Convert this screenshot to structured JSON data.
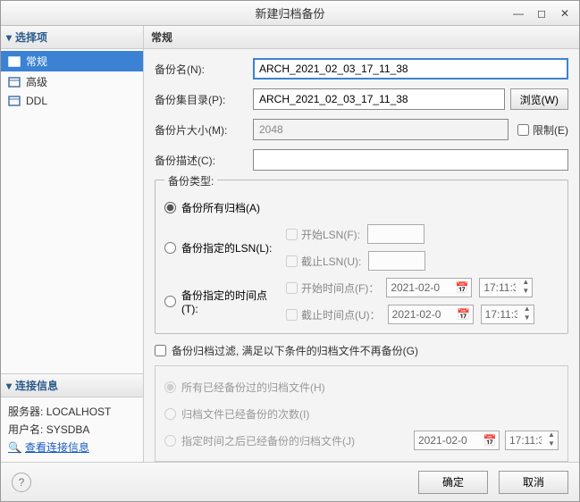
{
  "window": {
    "title": "新建归档备份"
  },
  "sidebar": {
    "options_header": "选择项",
    "items": [
      {
        "label": "常规"
      },
      {
        "label": "高级"
      },
      {
        "label": "DDL"
      }
    ],
    "conn_header": "连接信息",
    "server_label": "服务器:",
    "server_value": "LOCALHOST",
    "user_label": "用户名:",
    "user_value": "SYSDBA",
    "link": "查看连接信息"
  },
  "main": {
    "header": "常规",
    "name_label": "备份名(N):",
    "name_value": "ARCH_2021_02_03_17_11_38",
    "dir_label": "备份集目录(P):",
    "dir_value": "ARCH_2021_02_03_17_11_38",
    "browse": "浏览(W)",
    "size_label": "备份片大小(M):",
    "size_value": "2048",
    "limit": "限制(E)",
    "desc_label": "备份描述(C):"
  },
  "type": {
    "legend": "备份类型:",
    "all": "备份所有归档(A)",
    "lsn": "备份指定的LSN(L):",
    "lsn_start": "开始LSN(F):",
    "lsn_end": "截止LSN(U):",
    "time": "备份指定的时间点(T):",
    "time_start": "开始时间点(F)：",
    "time_end": "截止时间点(U)：",
    "date_value": "2021-02-0",
    "time_value": "17:11:3"
  },
  "filter": {
    "check": "备份归档过滤, 满足以下条件的归档文件不再备份(G)",
    "opt1": "所有已经备份过的归档文件(H)",
    "opt2": "归档文件已经备份的次数(I)",
    "opt3": "指定时间之后已经备份的归档文件(J)"
  },
  "footer": {
    "ok": "确定",
    "cancel": "取消"
  }
}
